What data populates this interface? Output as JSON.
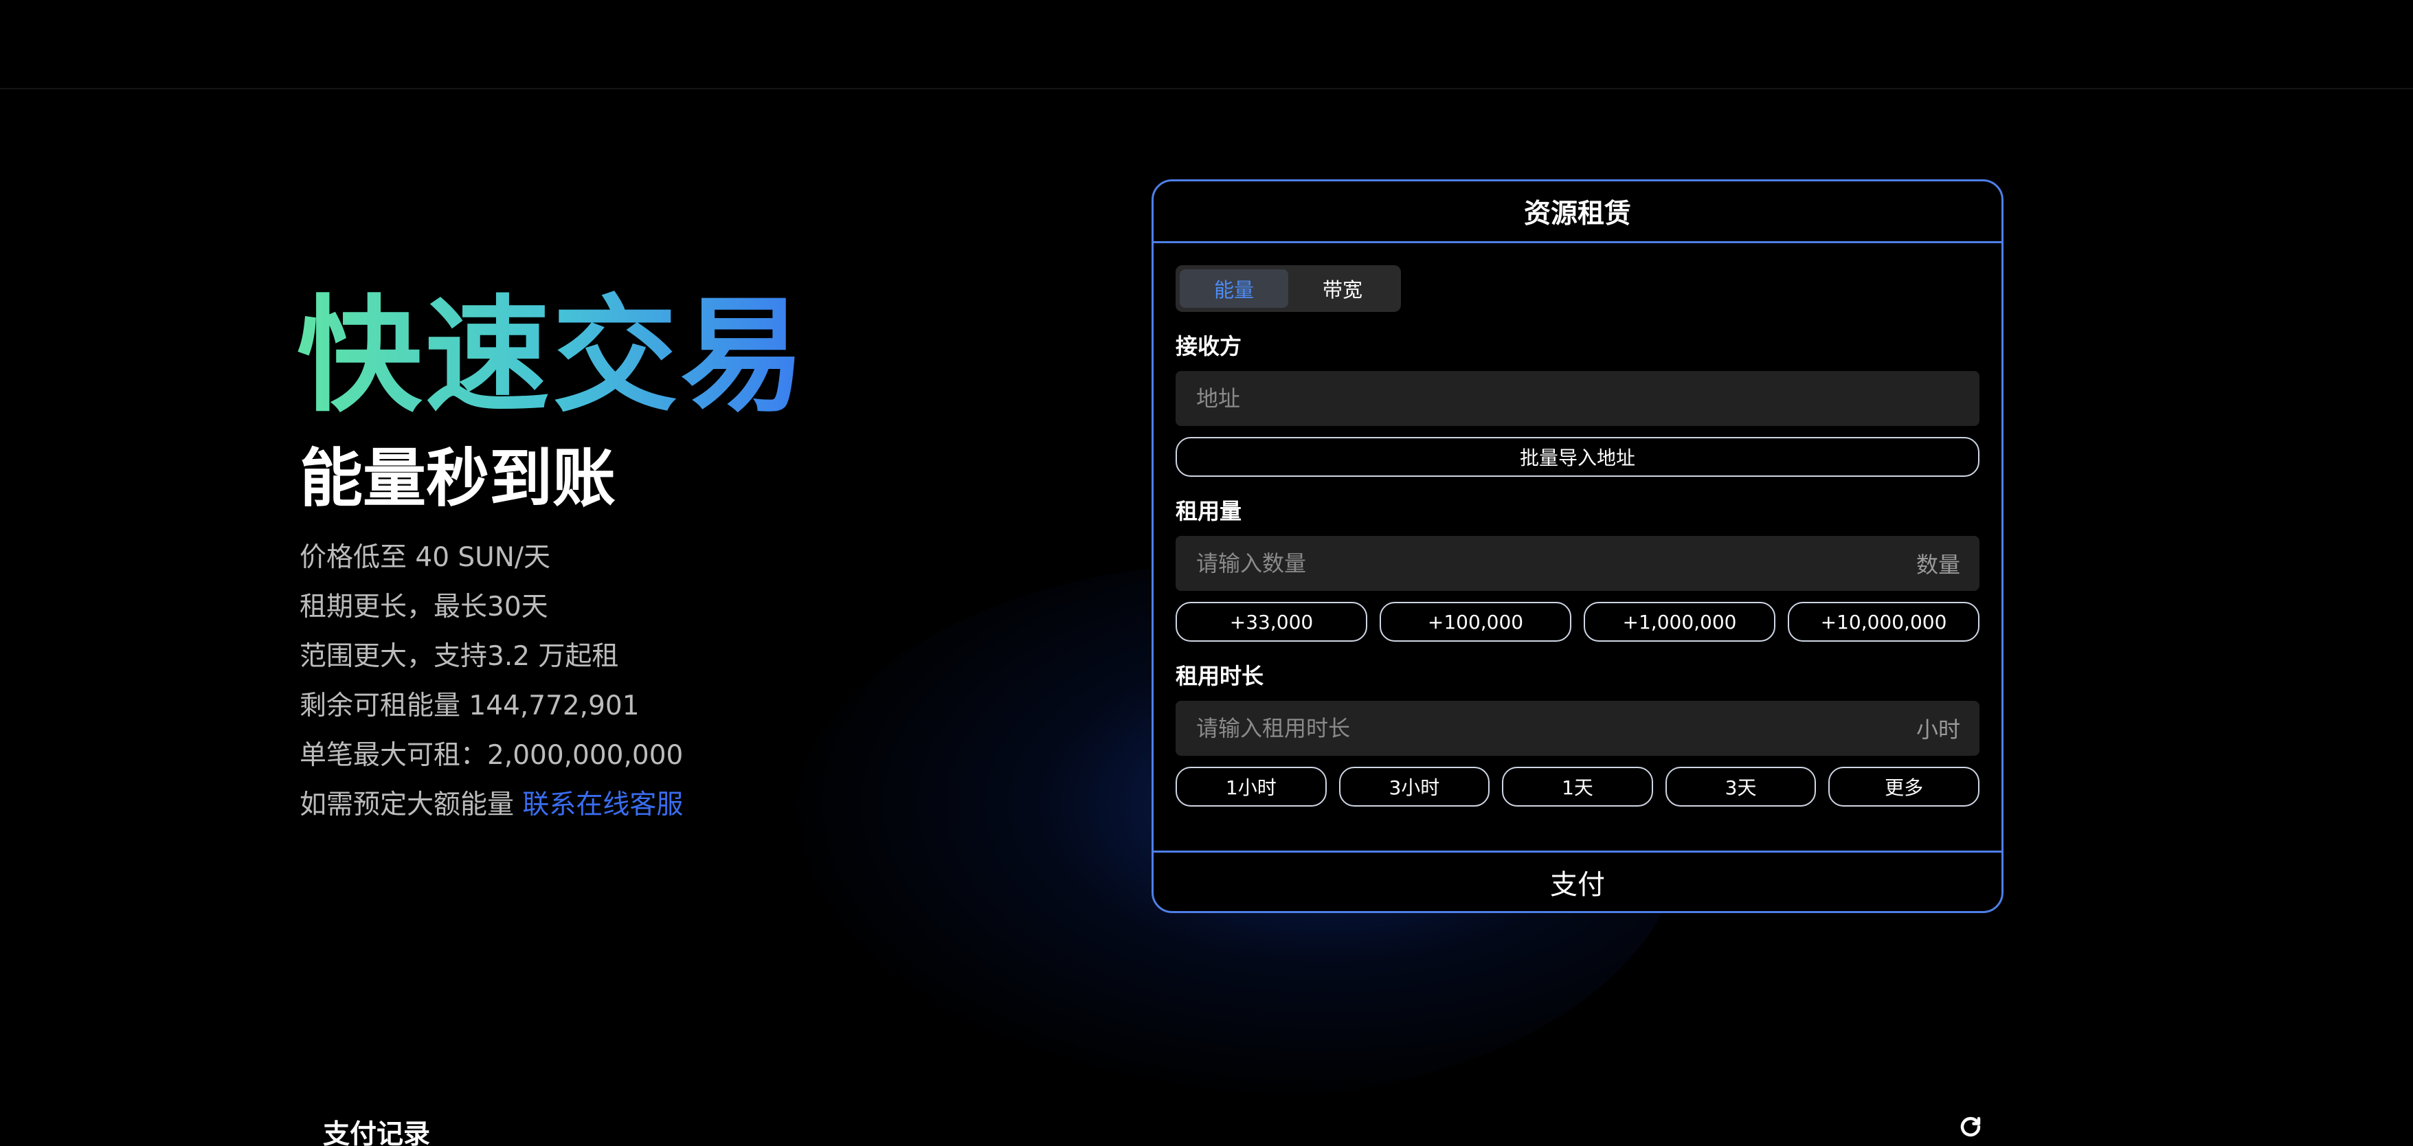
{
  "hero": {
    "title": "快速交易",
    "subtitle": "能量秒到账",
    "features": [
      "价格低至 40 SUN/天",
      "租期更长，最长30天",
      "范围更大，支持3.2 万起租",
      "剩余可租能量 144,772,901",
      "单笔最大可租：2,000,000,000"
    ],
    "contact_prefix": "如需预定大额能量 ",
    "contact_link": "联系在线客服"
  },
  "card": {
    "title": "资源租赁",
    "tabs": [
      {
        "label": "能量",
        "active": true
      },
      {
        "label": "带宽",
        "active": false
      }
    ],
    "receiver": {
      "label": "接收方",
      "placeholder": "地址",
      "value": "",
      "batch_button": "批量导入地址"
    },
    "amount": {
      "label": "租用量",
      "placeholder": "请输入数量",
      "value": "",
      "unit": "数量",
      "presets": [
        "+33,000",
        "+100,000",
        "+1,000,000",
        "+10,000,000"
      ]
    },
    "duration": {
      "label": "租用时长",
      "placeholder": "请输入租用时长",
      "value": "",
      "unit": "小时",
      "presets": [
        "1小时",
        "3小时",
        "1天",
        "3天",
        "更多"
      ]
    },
    "pay_button": "支付"
  },
  "records": {
    "title": "支付记录",
    "refresh_icon": "refresh-icon"
  },
  "colors": {
    "accent": "#3a6df0",
    "card_border": "#4e7fe8",
    "gradient_start": "#5fe3a6",
    "gradient_end": "#3a7cf0"
  }
}
